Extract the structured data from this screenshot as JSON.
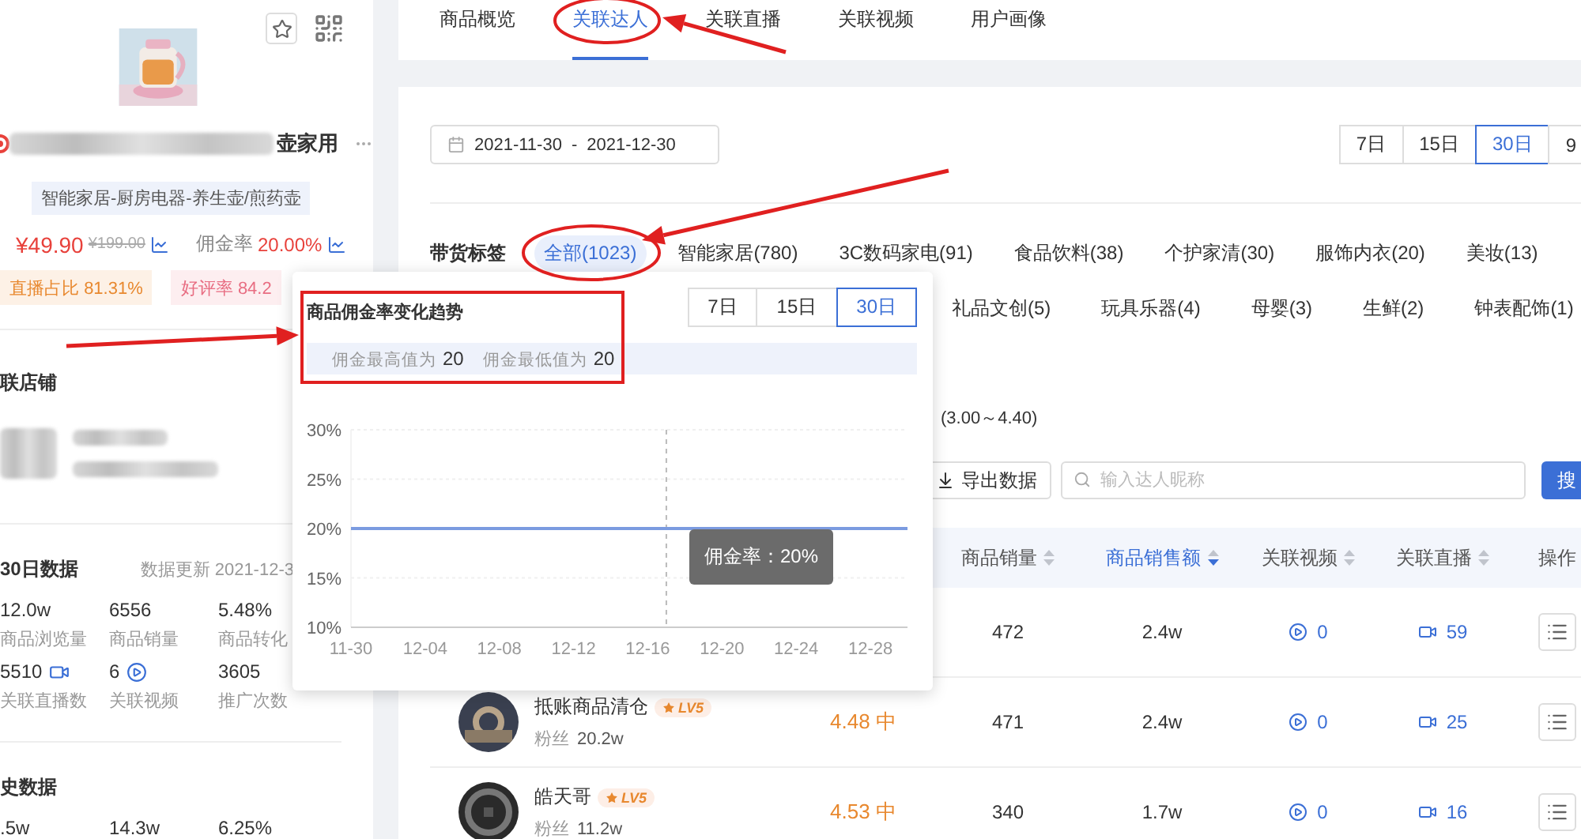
{
  "product": {
    "name_tail": "壶家用",
    "category": "智能家居-厨房电器-养生壶/煎药壶",
    "price": "¥49.90",
    "original_price": "¥199.00",
    "commission_label": "佣金率",
    "commission": "20.00%",
    "badges": [
      {
        "kind": "live",
        "label": "直播占比",
        "value": "81.31%"
      },
      {
        "kind": "rating",
        "label": "好评率",
        "value": "84.2"
      }
    ]
  },
  "shop": {
    "title": "联店铺"
  },
  "recent": {
    "title": "30日数据",
    "updated": "数据更新 2021-12-3",
    "stats": [
      {
        "kind": "plain",
        "value": "12.0w",
        "label": "商品浏览量"
      },
      {
        "kind": "plain",
        "value": "6556",
        "label": "商品销量"
      },
      {
        "kind": "plain",
        "value": "5.48%",
        "label": "商品转化"
      },
      {
        "kind": "live",
        "value": "5510",
        "label": "关联直播数"
      },
      {
        "kind": "video",
        "value": "6",
        "label": "关联视频"
      },
      {
        "kind": "plain",
        "value": "3605",
        "label": "推广次数"
      }
    ]
  },
  "history": {
    "title": "史数据",
    "stats": [
      {
        "value": ".5w"
      },
      {
        "value": "14.3w"
      },
      {
        "value": "6.25%"
      }
    ]
  },
  "tabs": [
    {
      "label": "商品概览",
      "selected": false
    },
    {
      "label": "关联达人",
      "selected": true
    },
    {
      "label": "关联直播",
      "selected": false
    },
    {
      "label": "关联视频",
      "selected": false
    },
    {
      "label": "用户画像",
      "selected": false
    }
  ],
  "date_range": {
    "start": "2021-11-30",
    "separator": "-",
    "end": "2021-12-30"
  },
  "periods": [
    {
      "label": "7日",
      "selected": false
    },
    {
      "label": "15日",
      "selected": false
    },
    {
      "label": "30日",
      "selected": true
    },
    {
      "label": "9",
      "selected": false
    }
  ],
  "filter": {
    "title": "带货标签",
    "tags": [
      {
        "label": "全部(1023)",
        "selected": true
      },
      {
        "label": "智能家居(780)",
        "selected": false
      },
      {
        "label": "3C数码家电(91)",
        "selected": false
      },
      {
        "label": "食品饮料(38)",
        "selected": false
      },
      {
        "label": "个护家清(30)",
        "selected": false
      },
      {
        "label": "服饰内衣(20)",
        "selected": false
      },
      {
        "label": "美妆(13)",
        "selected": false
      }
    ],
    "tags_row2": [
      {
        "label": "礼品文创(5)",
        "selected": false
      },
      {
        "label": "玩具乐器(4)",
        "selected": false
      },
      {
        "label": "母婴(3)",
        "selected": false
      },
      {
        "label": "生鲜(2)",
        "selected": false
      },
      {
        "label": "钟表配饰(1)",
        "selected": false
      }
    ]
  },
  "score_range": "(3.00～4.40)",
  "export_button": "导出数据",
  "search": {
    "placeholder": "输入达人昵称",
    "button": "搜"
  },
  "table": {
    "columns": [
      {
        "label": "商品销量",
        "sortable": true,
        "sorted": false
      },
      {
        "label": "商品销售额",
        "sortable": true,
        "sorted": true
      },
      {
        "label": "关联视频",
        "sortable": true,
        "sorted": false
      },
      {
        "label": "关联直播",
        "sortable": true,
        "sorted": false
      },
      {
        "label": "操作",
        "sortable": false,
        "sorted": false
      }
    ],
    "rows": [
      {
        "sales": "472",
        "revenue": "2.4w",
        "videos": "0",
        "lives": "59"
      },
      {
        "name": "抵账商品清仓",
        "level": "LV5",
        "fans_label": "粉丝",
        "fans": "20.2w",
        "score": "4.48 中",
        "sales": "471",
        "revenue": "2.4w",
        "videos": "0",
        "lives": "25"
      },
      {
        "name": "皓天哥",
        "level": "LV5",
        "fans_label": "粉丝",
        "fans": "11.2w",
        "score": "4.53 中",
        "sales": "340",
        "revenue": "1.7w",
        "videos": "0",
        "lives": "16"
      }
    ]
  },
  "popup": {
    "title": "商品佣金率变化趋势",
    "periods": [
      {
        "label": "7日",
        "selected": false
      },
      {
        "label": "15日",
        "selected": false
      },
      {
        "label": "30日",
        "selected": true
      }
    ],
    "max_label": "佣金最高值为",
    "max": "20",
    "min_label": "佣金最低值为",
    "min": "20",
    "tooltip": {
      "separator": "：",
      "value": "20%"
    },
    "chart_data": {
      "type": "line",
      "categories": [
        "11-30",
        null,
        null,
        null,
        "12-04",
        null,
        null,
        null,
        "12-08",
        null,
        null,
        null,
        "12-12",
        null,
        null,
        null,
        "12-16",
        null,
        null,
        null,
        "12-20",
        null,
        null,
        null,
        "12-24",
        null,
        null,
        null,
        "12-28",
        null,
        null
      ],
      "ylim": [
        10,
        30
      ],
      "yticks": [
        {
          "value": 30,
          "label": "30%"
        },
        {
          "value": 25,
          "label": "25%"
        },
        {
          "value": 20,
          "label": "20%"
        },
        {
          "value": 15,
          "label": "15%"
        },
        {
          "value": 10,
          "label": "10%"
        }
      ],
      "series": [
        {
          "name": "佣金率",
          "color": "#7b9be0",
          "values": [
            20,
            20,
            20,
            20,
            20,
            20,
            20,
            20,
            20,
            20,
            20,
            20,
            20,
            20,
            20,
            20,
            20,
            20,
            20,
            20,
            20,
            20,
            20,
            20,
            20,
            20,
            20,
            20,
            20,
            20,
            20
          ]
        }
      ]
    }
  }
}
